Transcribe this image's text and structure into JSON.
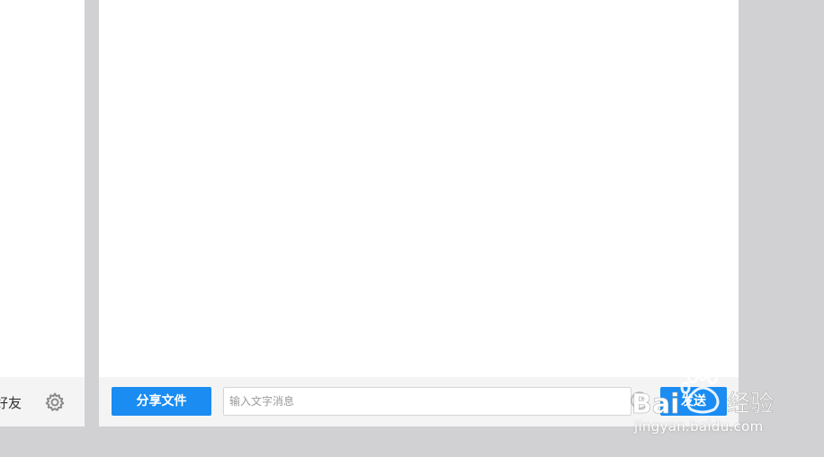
{
  "sidebar": {
    "footer": {
      "add_friend_label": "好友",
      "settings_icon": "gear-icon"
    }
  },
  "chat": {
    "footer": {
      "share_file_label": "分享文件",
      "message_input": {
        "value": "",
        "placeholder": "输入文字消息"
      },
      "emoji_icon": "emoji-icon",
      "send_label": "发送"
    }
  },
  "watermark": {
    "brand_latin": "Bai",
    "brand_cn": "经验",
    "url": "jingyan.baidu.com"
  },
  "colors": {
    "accent": "#1a8cf2",
    "background": "#d1d1d3",
    "panel": "#ffffff",
    "footer": "#f4f4f5"
  }
}
